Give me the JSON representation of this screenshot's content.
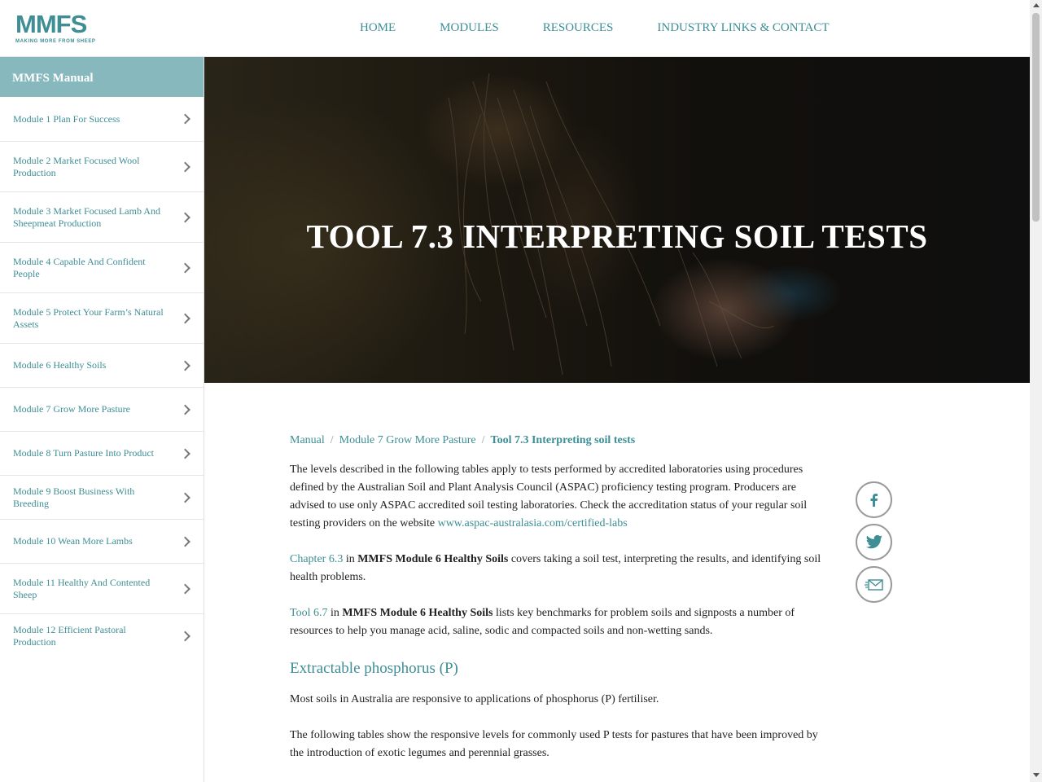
{
  "logo": {
    "text": "MMFS",
    "tagline": "MAKING MORE FROM SHEEP"
  },
  "nav": [
    "HOME",
    "MODULES",
    "RESOURCES",
    "INDUSTRY LINKS & CONTACT"
  ],
  "sidebar": {
    "title": "MMFS Manual",
    "items": [
      {
        "label": "Module 1 Plan For Success"
      },
      {
        "label": "Module 2 Market Focused Wool Production"
      },
      {
        "label": "Module 3 Market Focused Lamb And Sheepmeat Production"
      },
      {
        "label": "Module 4 Capable And Confident People"
      },
      {
        "label": "Module 5 Protect Your Farm’s Natural Assets"
      },
      {
        "label": "Module 6 Healthy Soils"
      },
      {
        "label": "Module 7 Grow More Pasture"
      },
      {
        "label": "Module 8 Turn Pasture Into Product"
      },
      {
        "label": "Module 9 Boost Business With Breeding"
      },
      {
        "label": "Module 10 Wean More Lambs"
      },
      {
        "label": "Module 11 Healthy And Contented Sheep"
      },
      {
        "label": "Module 12 Efficient Pastoral Production"
      }
    ]
  },
  "hero": {
    "title": "TOOL 7.3 INTERPRETING SOIL TESTS"
  },
  "breadcrumb": {
    "items": [
      "Manual",
      "Module 7 Grow More Pasture"
    ],
    "current": "Tool 7.3 Interpreting soil tests",
    "separator": "/"
  },
  "content": {
    "p1_text": "The levels described in the following tables apply to tests performed by accredited laboratories using procedures defined by the Australian Soil and Plant Analysis Council (ASPAC) proficiency testing program. Producers are advised to use only ASPAC accredited soil testing laboratories. Check the accreditation status of your regular soil testing providers on the website ",
    "p1_link": "www.aspac-australasia.com/certified-labs",
    "p2_link": "Chapter 6.3",
    "p2_in": " in ",
    "p2_bold": "MMFS Module 6 Healthy Soils",
    "p2_rest": " covers taking a soil test, interpreting the results, and identifying soil health problems.",
    "p3_link": "Tool 6.7",
    "p3_in": " in ",
    "p3_bold": "MMFS Module 6 Healthy Soils",
    "p3_rest": " lists key benchmarks for problem soils and signposts a number of resources to help you manage acid, saline, sodic and compacted soils and non-wetting sands.",
    "heading": "Extractable phosphorus (P)",
    "p4": "Most soils in Australia are responsive to applications of phosphorus (P) fertiliser.",
    "p5": "The following tables show the responsive levels for commonly used P tests for pastures that have been improved by the introduction of exotic legumes and perennial grasses."
  },
  "share": {
    "icons": [
      "facebook-icon",
      "twitter-icon",
      "email-icon"
    ]
  },
  "colors": {
    "accent": "#3d8e95",
    "sidebar_header": "#86b8bd"
  }
}
